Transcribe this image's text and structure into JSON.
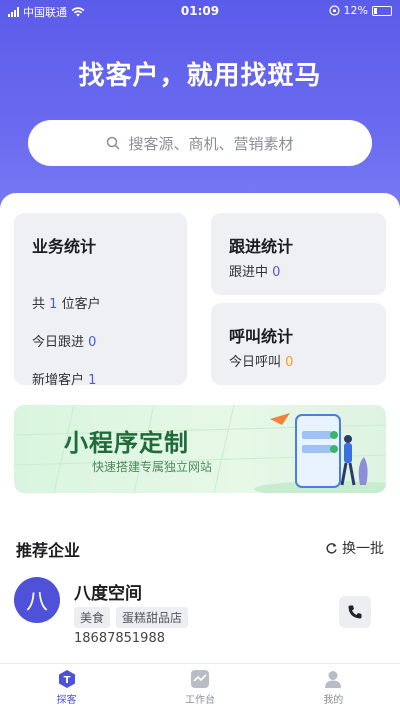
{
  "status_bar": {
    "carrier": "中国联通",
    "time": "01:09",
    "battery": "12%"
  },
  "hero": {
    "slogan": "找客户，就用找斑马"
  },
  "search": {
    "placeholder": "搜客源、商机、营销素材"
  },
  "business_stats": {
    "title": "业务统计",
    "total_prefix": "共",
    "total_value": "1",
    "total_suffix": "位客户",
    "today_follow_label": "今日跟进",
    "today_follow_value": "0",
    "new_customers_label": "新增客户",
    "new_customers_value": "1"
  },
  "follow_stats": {
    "title": "跟进统计",
    "label": "跟进中",
    "value": "0"
  },
  "call_stats": {
    "title": "呼叫统计",
    "label": "今日呼叫",
    "value": "0"
  },
  "banner": {
    "title": "小程序定制",
    "subtitle": "快速搭建专属独立网站"
  },
  "recommend": {
    "title": "推荐企业",
    "refresh_label": "换一批",
    "company": {
      "avatar_char": "八",
      "name": "八度空间",
      "tags": [
        "美食",
        "蛋糕甜品店"
      ],
      "phone": "18687851988"
    }
  },
  "tabbar": [
    {
      "label": "探客",
      "active": true
    },
    {
      "label": "工作台",
      "active": false
    },
    {
      "label": "我的",
      "active": false
    }
  ],
  "colors": {
    "primary": "#5b5bea",
    "accent_blue": "#4a5bd8",
    "accent_orange": "#f0a020",
    "banner_green": "#1f6b39"
  }
}
